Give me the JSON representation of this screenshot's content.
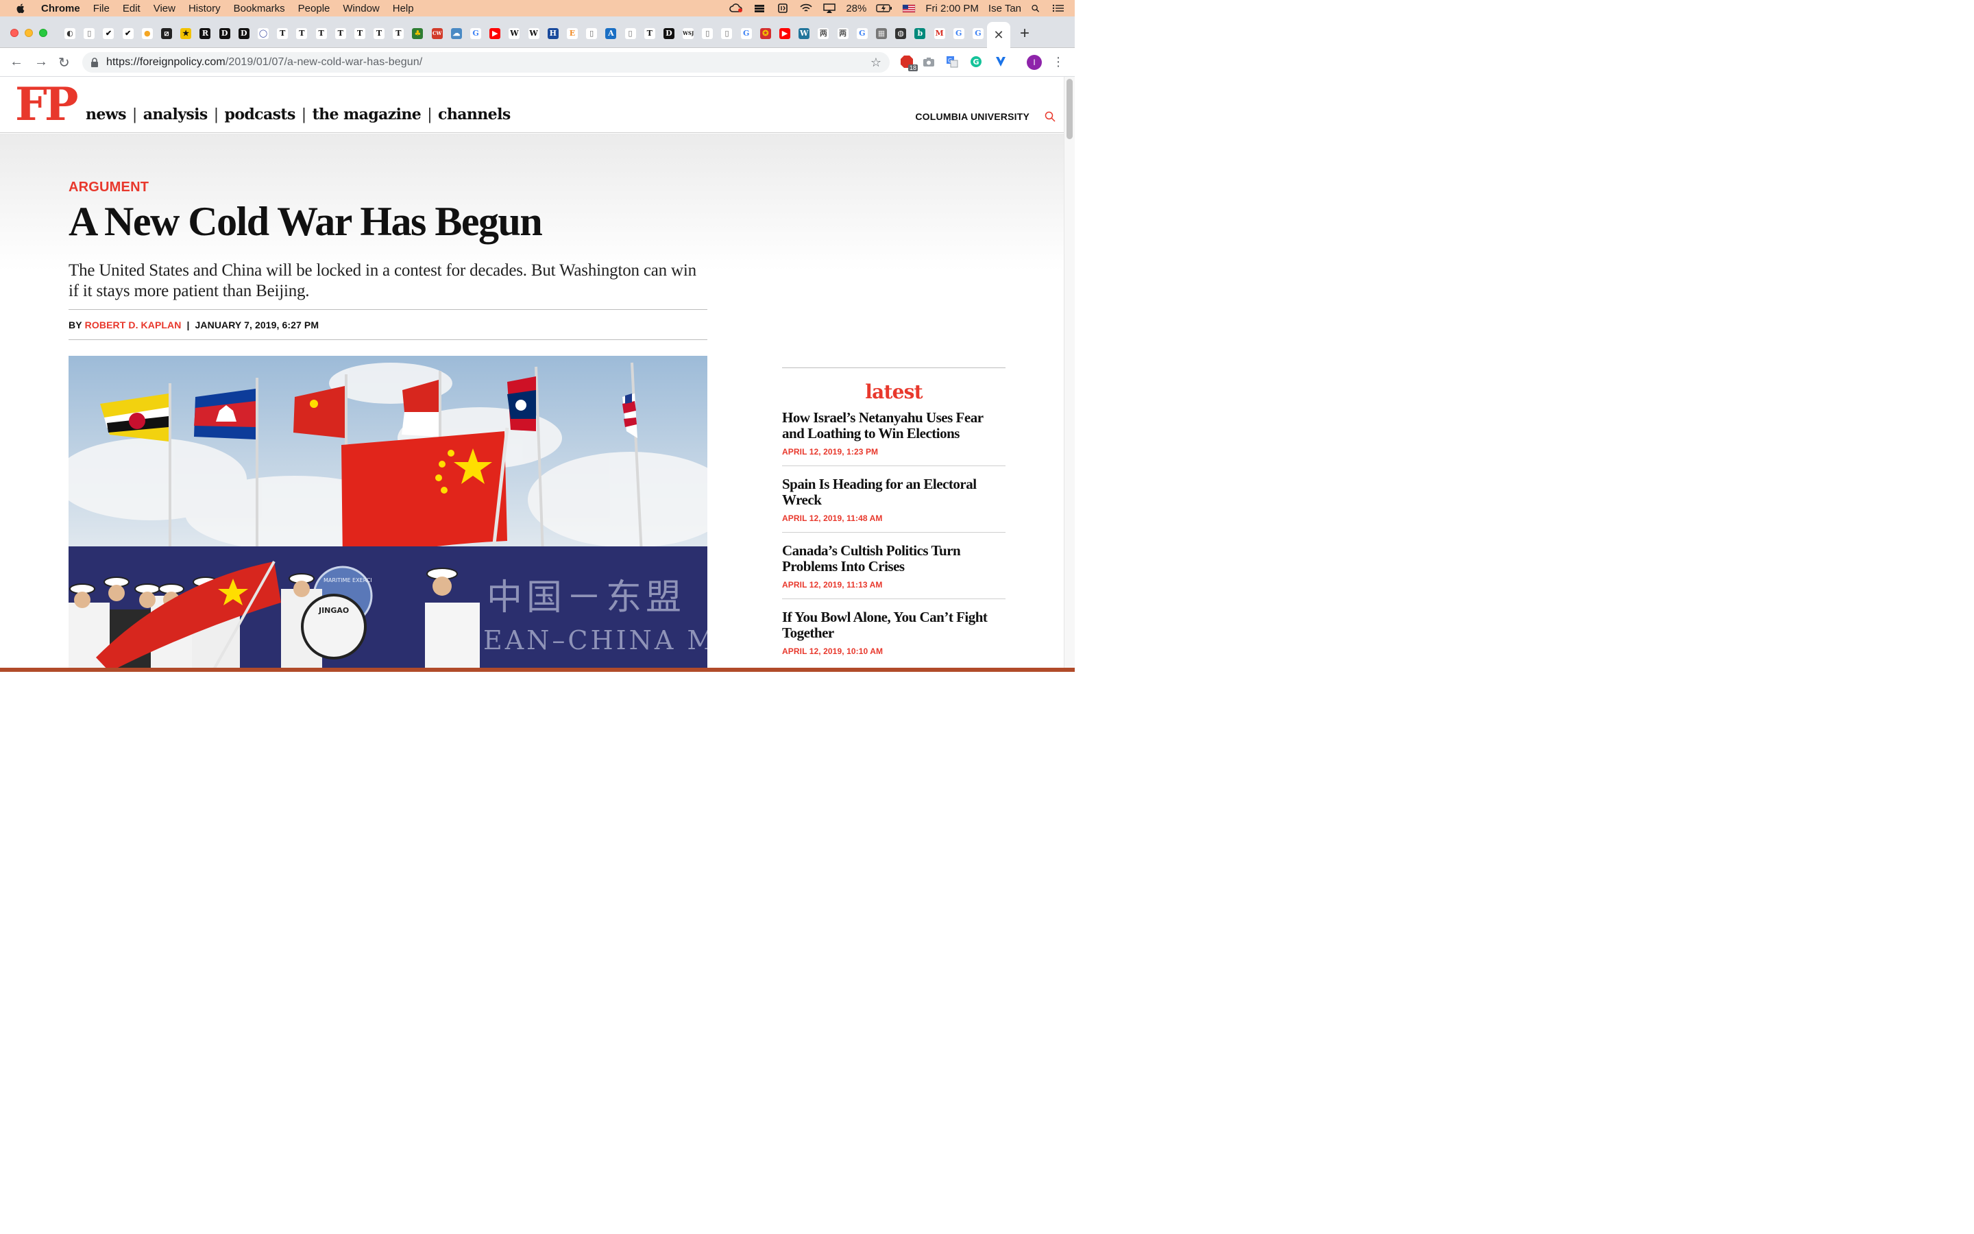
{
  "menubar": {
    "app": "Chrome",
    "items": [
      "File",
      "Edit",
      "View",
      "History",
      "Bookmarks",
      "People",
      "Window",
      "Help"
    ],
    "battery": "28%",
    "clock": "Fri 2:00 PM",
    "user": "Ise Tan"
  },
  "tabs": {
    "favicons": [
      {
        "icon": "fp-icon",
        "glyph": "◐",
        "bg": "#ffffff",
        "fg": "#333333"
      },
      {
        "icon": "doc-icon",
        "glyph": "▯",
        "bg": "#ffffff",
        "fg": "#666666"
      },
      {
        "icon": "check-icon",
        "glyph": "✔",
        "bg": "#ffffff",
        "fg": "#111111"
      },
      {
        "icon": "check-icon",
        "glyph": "✔",
        "bg": "#ffffff",
        "fg": "#111111"
      },
      {
        "icon": "chat-icon",
        "glyph": "●",
        "bg": "#ffffff",
        "fg": "#f4a623"
      },
      {
        "icon": "stripe-icon",
        "glyph": "⧄",
        "bg": "#222222",
        "fg": "#ffffff"
      },
      {
        "icon": "runner-icon",
        "glyph": "★",
        "bg": "#f2c200",
        "fg": "#111111"
      },
      {
        "icon": "r-icon",
        "glyph": "R",
        "bg": "#111111",
        "fg": "#ffffff"
      },
      {
        "icon": "d-icon",
        "glyph": "D",
        "bg": "#111111",
        "fg": "#ffffff"
      },
      {
        "icon": "d-icon",
        "glyph": "D",
        "bg": "#111111",
        "fg": "#ffffff"
      },
      {
        "icon": "ring-icon",
        "glyph": "◯",
        "bg": "#ffffff",
        "fg": "#3a4aa0"
      },
      {
        "icon": "nyt-icon",
        "glyph": "T",
        "bg": "#ffffff",
        "fg": "#111111"
      },
      {
        "icon": "nyt-icon",
        "glyph": "T",
        "bg": "#ffffff",
        "fg": "#111111"
      },
      {
        "icon": "nyt-icon",
        "glyph": "T",
        "bg": "#ffffff",
        "fg": "#111111"
      },
      {
        "icon": "nyt-icon",
        "glyph": "T",
        "bg": "#ffffff",
        "fg": "#111111"
      },
      {
        "icon": "nyt-icon",
        "glyph": "T",
        "bg": "#ffffff",
        "fg": "#111111"
      },
      {
        "icon": "nyt-icon",
        "glyph": "T",
        "bg": "#ffffff",
        "fg": "#111111"
      },
      {
        "icon": "nyt-icon",
        "glyph": "T",
        "bg": "#ffffff",
        "fg": "#111111"
      },
      {
        "icon": "tree-icon",
        "glyph": "♣",
        "bg": "#2e7d32",
        "fg": "#f2c200"
      },
      {
        "icon": "cw-icon",
        "glyph": "CW",
        "bg": "#d23b2a",
        "fg": "#ffffff"
      },
      {
        "icon": "cloud-icon",
        "glyph": "☁",
        "bg": "#4a8ac4",
        "fg": "#ffffff"
      },
      {
        "icon": "google-icon",
        "glyph": "G",
        "bg": "#ffffff",
        "fg": "#4285f4"
      },
      {
        "icon": "youtube-icon",
        "glyph": "▶",
        "bg": "#ff0000",
        "fg": "#ffffff"
      },
      {
        "icon": "wikipedia-icon",
        "glyph": "W",
        "bg": "#ffffff",
        "fg": "#111111"
      },
      {
        "icon": "wikipedia-icon",
        "glyph": "W",
        "bg": "#ffffff",
        "fg": "#111111"
      },
      {
        "icon": "h-icon",
        "glyph": "H",
        "bg": "#1a4a9c",
        "fg": "#ffffff"
      },
      {
        "icon": "e-icon",
        "glyph": "E",
        "bg": "#ffffff",
        "fg": "#f08a24"
      },
      {
        "icon": "doc-icon",
        "glyph": "▯",
        "bg": "#ffffff",
        "fg": "#666666"
      },
      {
        "icon": "a-icon",
        "glyph": "A",
        "bg": "#1a6fc4",
        "fg": "#ffffff"
      },
      {
        "icon": "doc-icon",
        "glyph": "▯",
        "bg": "#ffffff",
        "fg": "#666666"
      },
      {
        "icon": "nyt-icon",
        "glyph": "T",
        "bg": "#ffffff",
        "fg": "#111111"
      },
      {
        "icon": "d-icon",
        "glyph": "D",
        "bg": "#111111",
        "fg": "#ffffff"
      },
      {
        "icon": "wsj-icon",
        "glyph": "WSJ",
        "bg": "#ffffff",
        "fg": "#111111"
      },
      {
        "icon": "doc-icon",
        "glyph": "▯",
        "bg": "#ffffff",
        "fg": "#666666"
      },
      {
        "icon": "doc-icon",
        "glyph": "▯",
        "bg": "#ffffff",
        "fg": "#666666"
      },
      {
        "icon": "google-icon",
        "glyph": "G",
        "bg": "#ffffff",
        "fg": "#4285f4"
      },
      {
        "icon": "emblem-icon",
        "glyph": "✪",
        "bg": "#d32f2f",
        "fg": "#f2c200"
      },
      {
        "icon": "youtube-icon",
        "glyph": "▶",
        "bg": "#ff0000",
        "fg": "#ffffff"
      },
      {
        "icon": "wordpress-icon",
        "glyph": "W",
        "bg": "#21759b",
        "fg": "#ffffff"
      },
      {
        "icon": "glyph-icon",
        "glyph": "两",
        "bg": "#ffffff",
        "fg": "#555555"
      },
      {
        "icon": "glyph-icon",
        "glyph": "两",
        "bg": "#ffffff",
        "fg": "#555555"
      },
      {
        "icon": "google-icon",
        "glyph": "G",
        "bg": "#ffffff",
        "fg": "#4285f4"
      },
      {
        "icon": "photo-icon",
        "glyph": "▦",
        "bg": "#777777",
        "fg": "#dddddd"
      },
      {
        "icon": "globe-icon",
        "glyph": "◍",
        "bg": "#333333",
        "fg": "#ffffff"
      },
      {
        "icon": "bing-icon",
        "glyph": "b",
        "bg": "#00897b",
        "fg": "#ffffff"
      },
      {
        "icon": "gmail-icon",
        "glyph": "M",
        "bg": "#ffffff",
        "fg": "#d93025"
      },
      {
        "icon": "google-icon",
        "glyph": "G",
        "bg": "#ffffff",
        "fg": "#4285f4"
      },
      {
        "icon": "google-icon",
        "glyph": "G",
        "bg": "#ffffff",
        "fg": "#4285f4"
      }
    ],
    "close_glyph": "✕",
    "new_tab_glyph": "+"
  },
  "toolbar": {
    "back": "←",
    "forward": "→",
    "reload": "↻",
    "url_host": "https://foreignpolicy.com",
    "url_path": "/2019/01/07/a-new-cold-war-has-begun/",
    "star": "☆",
    "badge_count": "18",
    "profile_initial": "I",
    "menu": "⋮"
  },
  "site": {
    "logo": "FP",
    "nav": [
      "news",
      "analysis",
      "podcasts",
      "the magazine",
      "channels"
    ],
    "institution": "COLUMBIA UNIVERSITY"
  },
  "article": {
    "kicker": "ARGUMENT",
    "headline": "A New Cold War Has Begun",
    "dek": "The United States and China will be locked in a contest for decades. But Washington can win if it stays more patient than Beijing.",
    "byline_prefix": "BY",
    "author": "ROBERT D. KAPLAN",
    "date": "JANUARY 7, 2019, 6:27 PM",
    "image": {
      "banner_cn": "中国－东盟",
      "banner_en": "EAN–CHINA M",
      "drum_text": "JINGAO",
      "seal_text": "MARITIME EXERCI"
    }
  },
  "latest": {
    "title": "latest",
    "items": [
      {
        "headline": "How Israel’s Netanyahu Uses Fear and Loathing to Win Elections",
        "date": "APRIL 12, 2019, 1:23 PM"
      },
      {
        "headline": "Spain Is Heading for an Electoral Wreck",
        "date": "APRIL 12, 2019, 11:48 AM"
      },
      {
        "headline": "Canada’s Cultish Politics Turn Problems Into Crises",
        "date": "APRIL 12, 2019, 11:13 AM"
      },
      {
        "headline": "If You Bowl Alone, You Can’t Fight Together",
        "date": "APRIL 12, 2019, 10:10 AM"
      }
    ]
  },
  "colors": {
    "brand_red": "#e8382c",
    "menubar": "#f7c9a8",
    "navy_banner": "#2b2f6e"
  }
}
